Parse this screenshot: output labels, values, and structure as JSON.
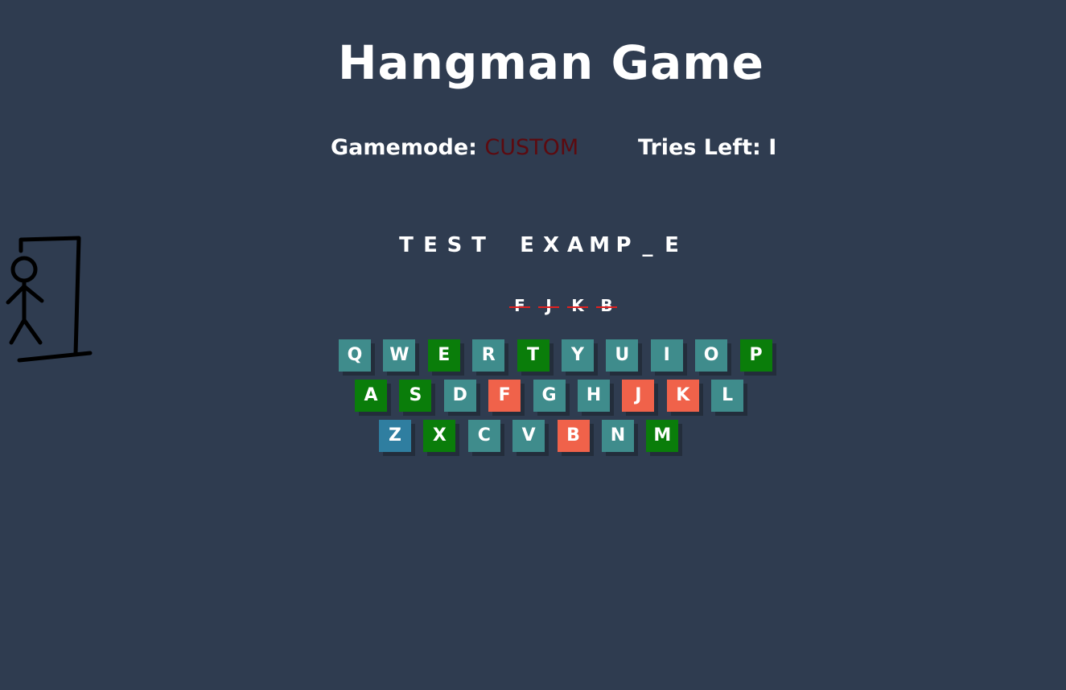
{
  "title": "Hangman Game",
  "status": {
    "mode_label": "Gamemode:",
    "mode_value": "CUSTOM",
    "tries_label": "Tries Left:",
    "tries_value": "I"
  },
  "word": [
    "T",
    "E",
    "S",
    "T",
    " ",
    "E",
    "X",
    "A",
    "M",
    "P",
    "_",
    "E"
  ],
  "wrong_guesses": [
    "F",
    "J",
    "K",
    "B"
  ],
  "keyboard": {
    "rows": [
      [
        {
          "key": "Q",
          "state": "unused"
        },
        {
          "key": "W",
          "state": "unused"
        },
        {
          "key": "E",
          "state": "correct"
        },
        {
          "key": "R",
          "state": "unused"
        },
        {
          "key": "T",
          "state": "correct"
        },
        {
          "key": "Y",
          "state": "unused"
        },
        {
          "key": "U",
          "state": "unused"
        },
        {
          "key": "I",
          "state": "unused"
        },
        {
          "key": "O",
          "state": "unused"
        },
        {
          "key": "P",
          "state": "correct"
        }
      ],
      [
        {
          "key": "A",
          "state": "correct"
        },
        {
          "key": "S",
          "state": "correct"
        },
        {
          "key": "D",
          "state": "unused"
        },
        {
          "key": "F",
          "state": "wrong"
        },
        {
          "key": "G",
          "state": "unused"
        },
        {
          "key": "H",
          "state": "unused"
        },
        {
          "key": "J",
          "state": "wrong"
        },
        {
          "key": "K",
          "state": "wrong"
        },
        {
          "key": "L",
          "state": "unused"
        }
      ],
      [
        {
          "key": "Z",
          "state": "focused"
        },
        {
          "key": "X",
          "state": "correct"
        },
        {
          "key": "C",
          "state": "unused"
        },
        {
          "key": "V",
          "state": "unused"
        },
        {
          "key": "B",
          "state": "wrong"
        },
        {
          "key": "N",
          "state": "unused"
        },
        {
          "key": "M",
          "state": "correct"
        }
      ]
    ]
  },
  "colors": {
    "background": "#2f3c50",
    "key_unused": "#3f8c8c",
    "key_correct": "#0a7d0a",
    "key_wrong": "#f0624a",
    "key_focused": "#2f7ea0",
    "mode_value": "#5c0a0f"
  },
  "hangman_figure": "stick-figure-gallows-icon"
}
